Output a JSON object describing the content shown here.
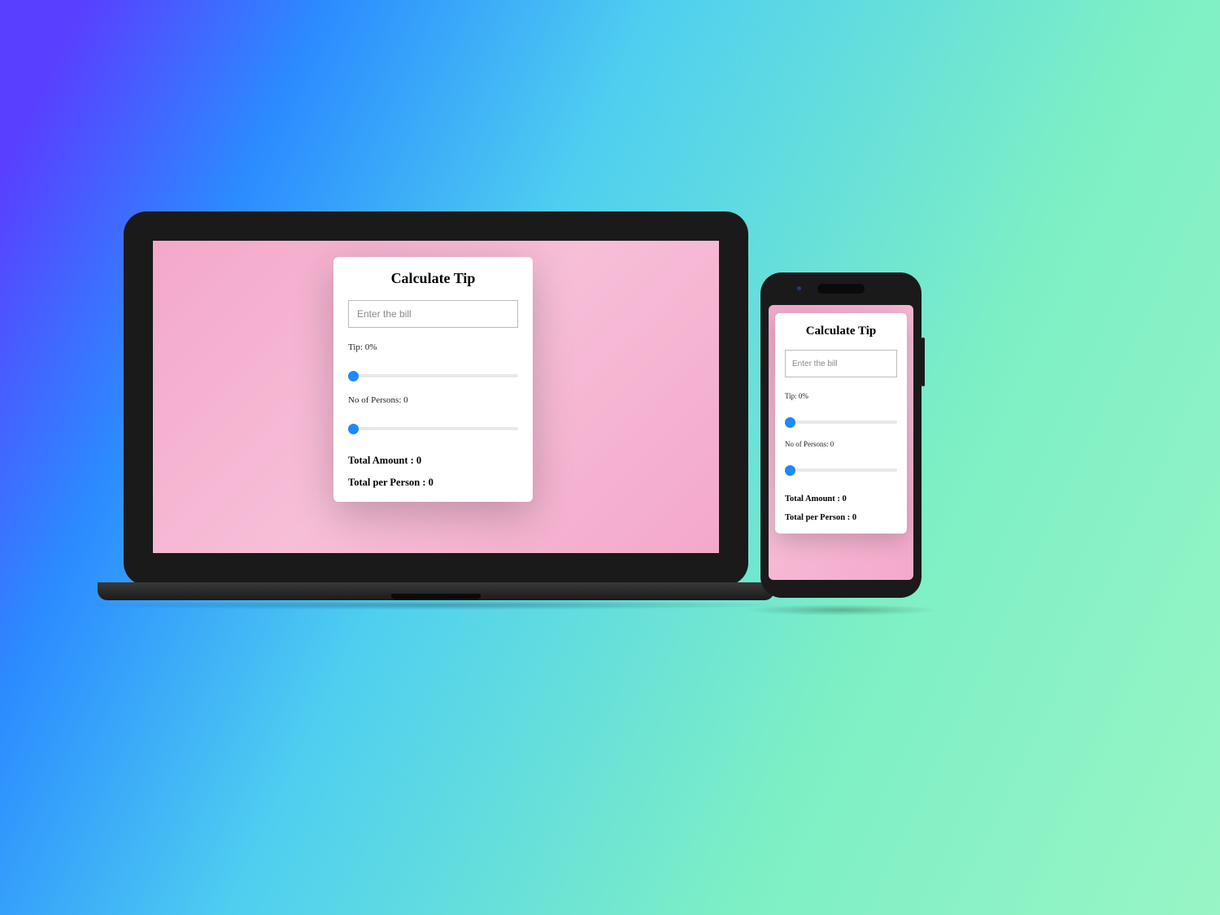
{
  "app": {
    "title": "Calculate Tip",
    "bill_placeholder": "Enter the bill",
    "tip_label_prefix": "Tip: ",
    "tip_value": 0,
    "tip_suffix": "%",
    "tip_display": "Tip: 0%",
    "persons_label_prefix": "No of Persons: ",
    "persons_value": 0,
    "persons_display": "No of Persons: 0",
    "total_amount_label": "Total Amount : ",
    "total_amount_value": 0,
    "total_amount_display": "Total Amount : 0",
    "total_per_person_label": "Total per Person : ",
    "total_per_person_value": 0,
    "total_per_person_display": "Total per Person : 0",
    "slider_tip": {
      "min": 0,
      "max": 100,
      "value": 0
    },
    "slider_persons": {
      "min": 0,
      "max": 20,
      "value": 0
    }
  }
}
